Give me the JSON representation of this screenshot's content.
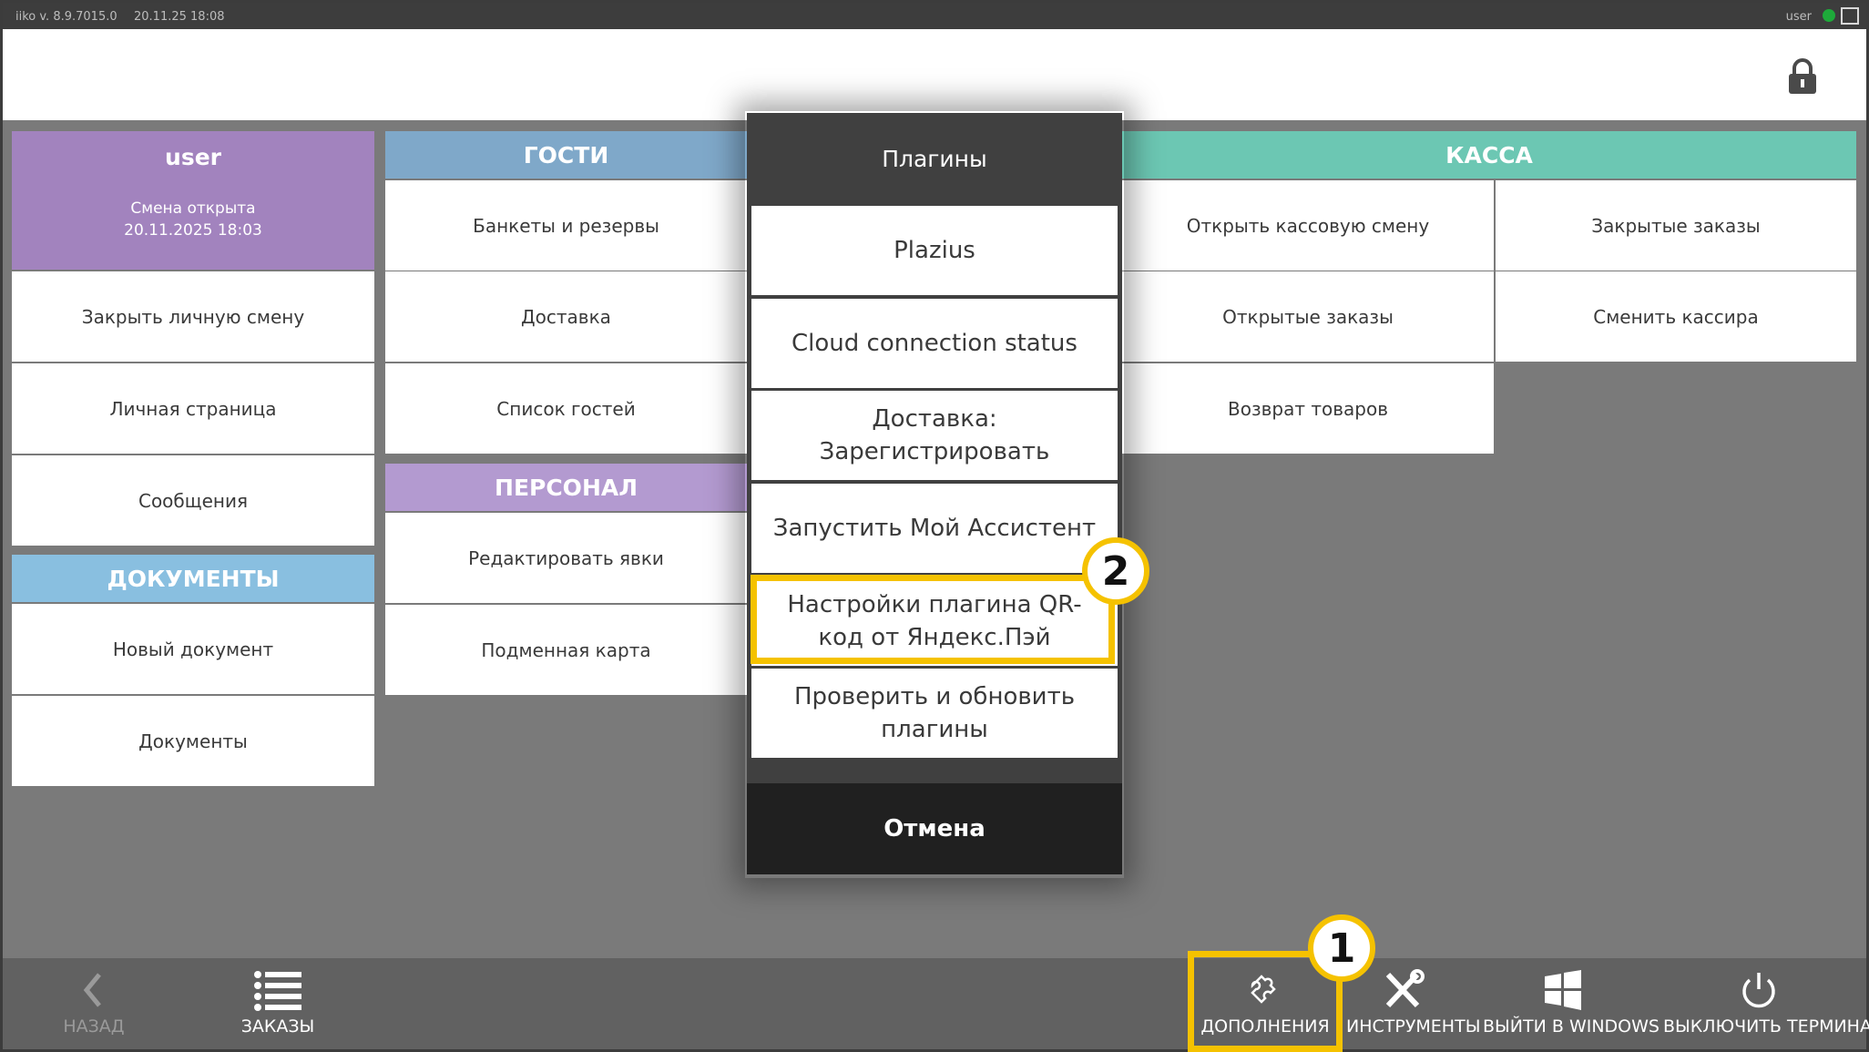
{
  "topbar": {
    "version": "iiko  v. 8.9.7015.0",
    "datetime": "20.11.25   18:08",
    "user": "user"
  },
  "user_card": {
    "name": "user",
    "status_line1": "Смена открыта",
    "status_line2": "20.11.2025 18:03"
  },
  "user_items": [
    "Закрыть личную смену",
    "Личная страница",
    "Сообщения"
  ],
  "documents": {
    "header": "ДОКУМЕНТЫ",
    "items": [
      "Новый документ",
      "Документы"
    ]
  },
  "guests": {
    "header": "ГОСТИ",
    "items": [
      "Банкеты и резервы",
      "Доставка",
      "Список гостей"
    ]
  },
  "staff": {
    "header": "ПЕРСОНАЛ",
    "items": [
      "Редактировать явки",
      "Подменная карта"
    ]
  },
  "kassa": {
    "header": "КАССА",
    "items": [
      "Открыть кассовую смену",
      "Закрытые заказы",
      "Открытые заказы",
      "Сменить кассира",
      "Возврат товаров"
    ]
  },
  "plugins_modal": {
    "title": "Плагины",
    "items": [
      "Plazius",
      "Cloud connection status",
      "Доставка: Зарегистрировать",
      "Запустить Мой Ассистент",
      "Настройки плагина QR-код от Яндекс.Пэй",
      "Проверить и обновить плагины"
    ],
    "cancel": "Отмена"
  },
  "badges": {
    "one": "1",
    "two": "2"
  },
  "bottombar": {
    "back": "НАЗАД",
    "orders": "ЗАКАЗЫ",
    "addons": "ДОПОЛНЕНИЯ",
    "tools": "ИНСТРУМЕНТЫ",
    "exit_windows": "ВЫЙТИ В WINDOWS",
    "shutdown": "ВЫКЛЮЧИТЬ ТЕРМИНАЛ"
  },
  "colors": {
    "user_purple": "#a283be",
    "guests_blue": "#7fa8c9",
    "staff_purple": "#b39ad0",
    "documents_blue": "#89bfe0",
    "kassa_teal": "#6cc7b3",
    "highlight": "#f5c200"
  },
  "icons": {
    "lock": "lock-icon",
    "back": "chevron-left-icon",
    "orders": "list-icon",
    "addons": "puzzle-icon",
    "tools": "tools-icon",
    "windows": "windows-icon",
    "power": "power-icon"
  }
}
